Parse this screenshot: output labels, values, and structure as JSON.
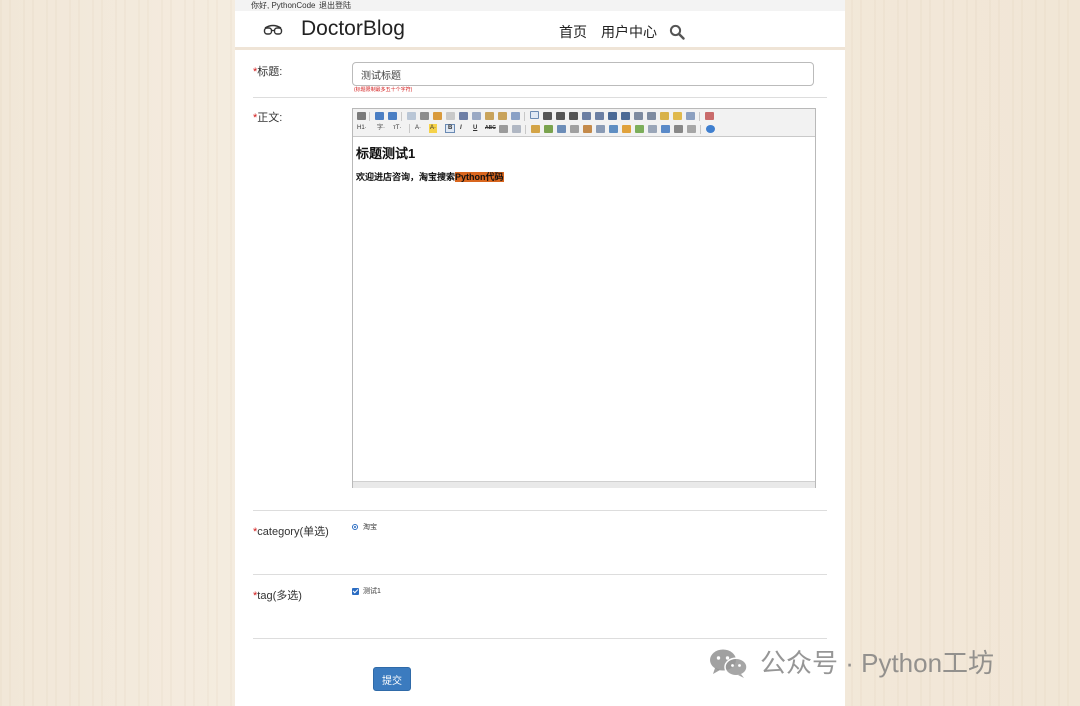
{
  "topbar": {
    "greeting": "你好, PythonCode",
    "logout": "退出登陆"
  },
  "navbar": {
    "brand": "DoctorBlog",
    "logo_icon": "glasses-icon",
    "links": [
      {
        "label": "首页"
      },
      {
        "label": "用户中心"
      }
    ],
    "search_icon": "search-icon"
  },
  "form": {
    "required_mark": "*",
    "title": {
      "label": "标题:",
      "value": "测试标题",
      "hint": "(标题限制最多五十个字符)"
    },
    "body": {
      "label": "正文:",
      "toolbar_labels": {
        "heading": "H1·",
        "font_family": "字·",
        "font_size": "тT·",
        "font_color": "A·",
        "highlight": "A·",
        "bold": "B",
        "italic": "I",
        "underline": "U",
        "strike": "ABC"
      },
      "content_heading": "标题测试1",
      "content_text_before": "欢迎进店咨询，淘宝搜索",
      "content_text_highlight": "Python代码",
      "highlight_color": "#d9661e"
    },
    "category": {
      "label": "category(单选)",
      "option_label": "淘宝",
      "checked": true
    },
    "tag": {
      "label": "tag(多选)",
      "option_label": "测试1",
      "checked": true
    },
    "submit_label": "提交"
  },
  "watermark": {
    "text": "公众号 · Python工坊",
    "icon": "wechat-icon"
  },
  "colors": {
    "accent": "#3b7bbf",
    "required": "#d21a1a",
    "page_background": "#f3e9db"
  }
}
